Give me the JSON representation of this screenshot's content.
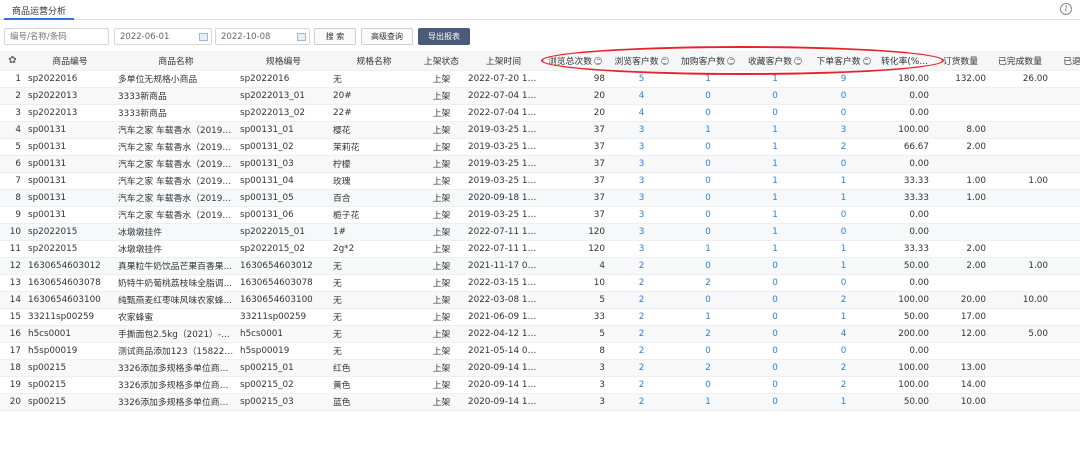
{
  "tab": {
    "label": "商品运营分析"
  },
  "search": {
    "placeholder": "编号/名称/条码",
    "date_start": "2022-06-01",
    "date_end": "2022-10-08"
  },
  "toolbar": {
    "search_label": "搜 索",
    "advanced_label": "高级查询",
    "export_label": "导出报表"
  },
  "columns": [
    "商品编号",
    "商品名称",
    "规格编号",
    "规格名称",
    "上架状态",
    "上架时间",
    "浏览总次数",
    "浏览客户数",
    "加购客户数",
    "收藏客户数",
    "下单客户数",
    "转化率(%)",
    "订货数量",
    "已完成数量",
    "已退"
  ],
  "rows": [
    [
      "1",
      "sp2022016",
      "多单位无规格小商品",
      "sp2022016",
      "无",
      "上架",
      "2022-07-20 14:...",
      "98",
      "5",
      "1",
      "1",
      "9",
      "180.00",
      "132.00",
      "26.00"
    ],
    [
      "2",
      "sp2022013",
      "3333新商品",
      "sp2022013_01",
      "20#",
      "上架",
      "2022-07-04 15:...",
      "20",
      "4",
      "0",
      "0",
      "0",
      "0.00",
      "",
      ""
    ],
    [
      "3",
      "sp2022013",
      "3333新商品",
      "sp2022013_02",
      "22#",
      "上架",
      "2022-07-04 15:...",
      "20",
      "4",
      "0",
      "0",
      "0",
      "0.00",
      "",
      ""
    ],
    [
      "4",
      "sp00131",
      "汽车之家 车载香水（2019z...",
      "sp00131_01",
      "樱花",
      "上架",
      "2019-03-25 14:...",
      "37",
      "3",
      "1",
      "1",
      "3",
      "100.00",
      "8.00",
      ""
    ],
    [
      "5",
      "sp00131",
      "汽车之家 车载香水（2019z...",
      "sp00131_02",
      "茉莉花",
      "上架",
      "2019-03-25 14:...",
      "37",
      "3",
      "0",
      "1",
      "2",
      "66.67",
      "2.00",
      ""
    ],
    [
      "6",
      "sp00131",
      "汽车之家 车载香水（2019z...",
      "sp00131_03",
      "柠檬",
      "上架",
      "2019-03-25 14:...",
      "37",
      "3",
      "0",
      "1",
      "0",
      "0.00",
      "",
      ""
    ],
    [
      "7",
      "sp00131",
      "汽车之家 车载香水（2019z...",
      "sp00131_04",
      "玫瑰",
      "上架",
      "2019-03-25 14:...",
      "37",
      "3",
      "0",
      "1",
      "1",
      "33.33",
      "1.00",
      "1.00"
    ],
    [
      "8",
      "sp00131",
      "汽车之家 车载香水（2019z...",
      "sp00131_05",
      "百合",
      "上架",
      "2020-09-18 15:...",
      "37",
      "3",
      "0",
      "1",
      "1",
      "33.33",
      "1.00",
      ""
    ],
    [
      "9",
      "sp00131",
      "汽车之家 车载香水（2019z...",
      "sp00131_06",
      "栀子花",
      "上架",
      "2019-03-25 14:...",
      "37",
      "3",
      "0",
      "1",
      "0",
      "0.00",
      "",
      ""
    ],
    [
      "10",
      "sp2022015",
      "冰墩墩挂件",
      "sp2022015_01",
      "1#",
      "上架",
      "2022-07-11 11:38",
      "120",
      "3",
      "0",
      "1",
      "0",
      "0.00",
      "",
      ""
    ],
    [
      "11",
      "sp2022015",
      "冰墩墩挂件",
      "sp2022015_02",
      "2g*2",
      "上架",
      "2022-07-11 11:38",
      "120",
      "3",
      "1",
      "1",
      "1",
      "33.33",
      "2.00",
      ""
    ],
    [
      "12",
      "1630654603012",
      "真果粒牛奶饮品芒果百香果...",
      "1630654603012",
      "无",
      "上架",
      "2021-11-17 08:...",
      "4",
      "2",
      "0",
      "0",
      "1",
      "50.00",
      "2.00",
      "1.00"
    ],
    [
      "13",
      "1630654603078",
      "奶特牛奶葡桃荔枝味全脂调...",
      "1630654603078",
      "无",
      "上架",
      "2022-03-15 11:...",
      "10",
      "2",
      "2",
      "0",
      "0",
      "0.00",
      "",
      ""
    ],
    [
      "14",
      "1630654603100",
      "纯甄燕麦红枣味风味农家蜂...",
      "1630654603100",
      "无",
      "上架",
      "2022-03-08 16:...",
      "5",
      "2",
      "0",
      "0",
      "2",
      "100.00",
      "20.00",
      "10.00"
    ],
    [
      "15",
      "33211sp00259",
      "农家蜂蜜",
      "33211sp00259",
      "无",
      "上架",
      "2021-06-09 14:...",
      "33",
      "2",
      "1",
      "0",
      "1",
      "50.00",
      "17.00",
      ""
    ],
    [
      "16",
      "h5cs0001",
      "手撕面包2.5kg（2021）-1*2...",
      "h5cs0001",
      "无",
      "上架",
      "2022-04-12 15:...",
      "5",
      "2",
      "2",
      "0",
      "4",
      "200.00",
      "12.00",
      "5.00"
    ],
    [
      "17",
      "h5sp00019",
      "测试商品添加123（1582221...",
      "h5sp00019",
      "无",
      "上架",
      "2021-05-14 09:...",
      "8",
      "2",
      "0",
      "0",
      "0",
      "0.00",
      "",
      ""
    ],
    [
      "18",
      "sp00215",
      "3326添加多规格多单位商品...",
      "sp00215_01",
      "红色",
      "上架",
      "2020-09-14 10:...",
      "3",
      "2",
      "2",
      "0",
      "2",
      "100.00",
      "13.00",
      ""
    ],
    [
      "19",
      "sp00215",
      "3326添加多规格多单位商品...",
      "sp00215_02",
      "黄色",
      "上架",
      "2020-09-14 10:...",
      "3",
      "2",
      "0",
      "0",
      "2",
      "100.00",
      "14.00",
      ""
    ],
    [
      "20",
      "sp00215",
      "3326添加多规格多单位商品...",
      "sp00215_03",
      "蓝色",
      "上架",
      "2020-09-14 10:...",
      "3",
      "2",
      "1",
      "0",
      "1",
      "50.00",
      "10.00",
      ""
    ]
  ],
  "colors": {
    "accent": "#3c6fd6",
    "link_blue": "#2f7fd8",
    "highlight_red": "#e8222a",
    "export_bg": "#4a5a78"
  },
  "icons": {
    "settings": "gear-icon",
    "info": "info-icon",
    "calendar": "calendar-icon",
    "sort": "sort-icon",
    "help": "question-icon"
  }
}
